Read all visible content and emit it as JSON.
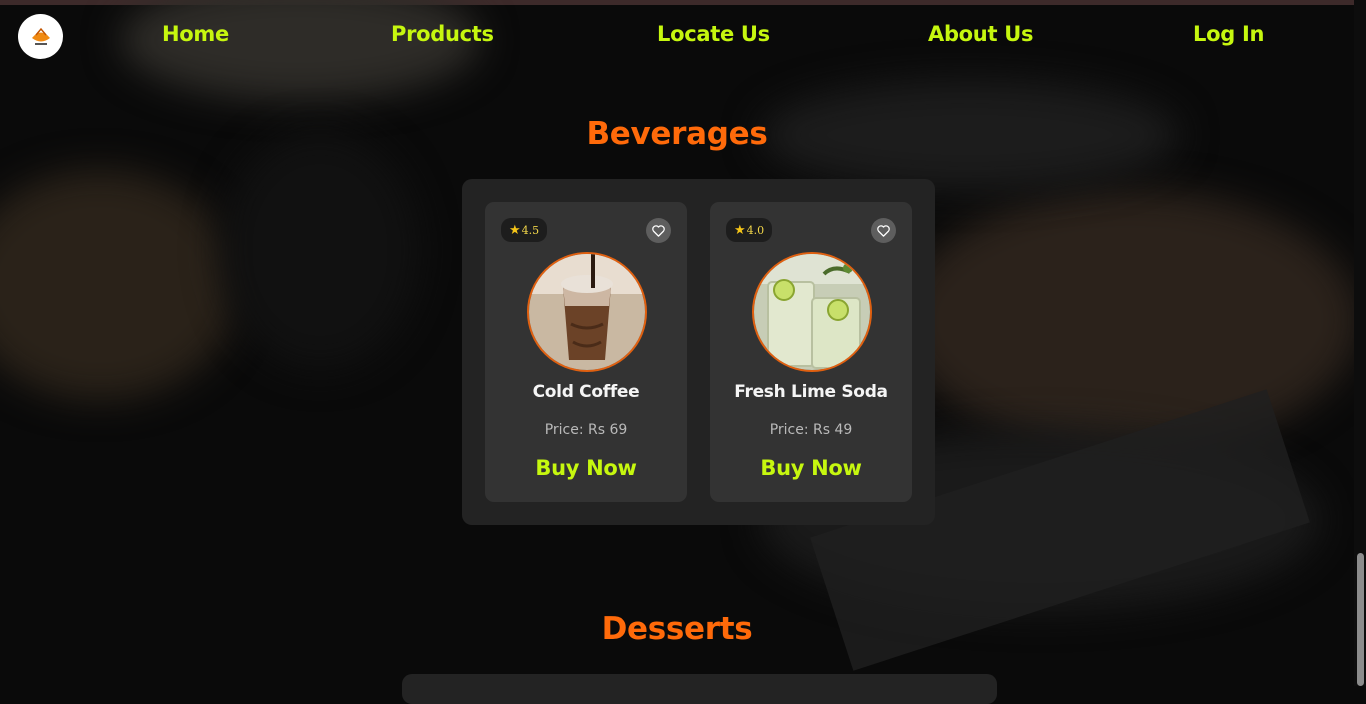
{
  "nav": {
    "logo_icon": "bakery-logo-icon",
    "links": [
      "Home",
      "Products",
      "Locate Us",
      "About Us",
      "Log In"
    ]
  },
  "sections": {
    "beverages": {
      "title": "Beverages",
      "products": [
        {
          "name": "Cold Coffee",
          "rating": "4.5",
          "price": "Price: Rs 69",
          "cta": "Buy Now",
          "image_icon": "cold-coffee-image",
          "favorite_icon": "heart-icon"
        },
        {
          "name": "Fresh Lime Soda",
          "rating": "4.0",
          "price": "Price: Rs 49",
          "cta": "Buy Now",
          "image_icon": "lime-soda-image",
          "favorite_icon": "heart-icon"
        }
      ]
    },
    "desserts": {
      "title": "Desserts"
    }
  },
  "colors": {
    "accent_lime": "#c6f70f",
    "accent_orange": "#ff6a0a",
    "panel": "#232323",
    "card": "#333333",
    "rating_star": "#f5c518"
  }
}
